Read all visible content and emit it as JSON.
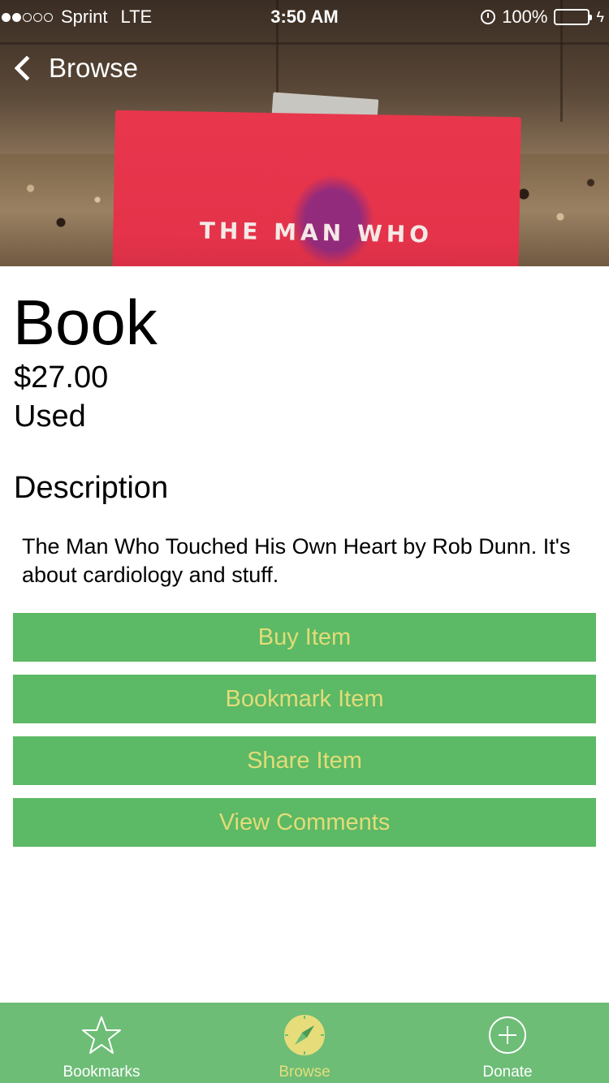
{
  "status_bar": {
    "carrier": "Sprint",
    "network": "LTE",
    "time": "3:50 AM",
    "battery": "100%",
    "signal_bars_filled": 2,
    "signal_bars_total": 5
  },
  "nav": {
    "back_label": "Browse"
  },
  "hero": {
    "book_cover_text": "THE MAN WHO"
  },
  "item": {
    "title": "Book",
    "price": "$27.00",
    "condition": "Used",
    "description_heading": "Description",
    "description": "The Man Who Touched His Own Heart by Rob Dunn. It's about cardiology and stuff."
  },
  "actions": {
    "buy_label": "Buy Item",
    "bookmark_label": "Bookmark Item",
    "share_label": "Share Item",
    "comments_label": "View Comments"
  },
  "tab_bar": {
    "tabs": [
      {
        "label": "Bookmarks",
        "icon": "star-icon",
        "active": false
      },
      {
        "label": "Browse",
        "icon": "compass-icon",
        "active": true
      },
      {
        "label": "Donate",
        "icon": "plus-circle-icon",
        "active": false
      }
    ]
  },
  "colors": {
    "button_bg": "#5cb965",
    "button_text": "#e2dc78",
    "tabbar_bg": "#6dbd76",
    "active_tab": "#e6dd7a"
  }
}
